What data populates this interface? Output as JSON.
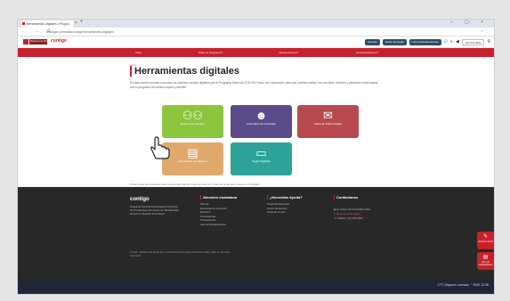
{
  "browser": {
    "tab_title": "Herramientas digitales | Progra...",
    "tab_close": "×",
    "new_tab": "+",
    "window_controls": "–  ▢  ×",
    "nav_icons": "←  →  ⟳",
    "url": "www.gob.pe/midis/contigo/herramientas-digitales",
    "right_icons": "☆  ⋮"
  },
  "gob_header": {
    "ministry_label": "Ministerio de Desarrollo",
    "brand": "contigo",
    "pills": [
      "Atención",
      "Centro de Ayuda",
      "Libro de Reclamaciones"
    ],
    "phone": "(01) 631 8000",
    "icons": [
      "person-icon",
      "settings-icon",
      "speaker-icon",
      "search-icon"
    ]
  },
  "nav": {
    "items": [
      "Inicio",
      "Sobre el programa ▾",
      "Intervenciones ▾",
      "Comunicaciones ▾"
    ]
  },
  "main": {
    "breadcrumb": "Inicio /",
    "title": "Herramientas digitales",
    "intro": "En esta sección podrás encontrar los distintos canales digitales que el Programa Nacional CONTIGO pone a tu disposición para que puedas realizar tus consultas, trámites y gestiones relacionadas con el programa de manera rápida y sencilla.",
    "tiles": [
      {
        "label": "Sistema de Usuarios",
        "icon": "people-icon",
        "color": "#8cc63f"
      },
      {
        "label": "Formulario de Consultas",
        "icon": "group-icon",
        "color": "#5b4b8a"
      },
      {
        "label": "Mesa de Partes Digital",
        "icon": "mail-icon",
        "color": "#b84a4f"
      },
      {
        "label": "Constancias de Afiliación",
        "icon": "document-icon",
        "color": "#e0a96d"
      },
      {
        "label": "Pagos Digitales",
        "icon": "payment-icon",
        "color": "#2fa39a"
      }
    ],
    "footnote": "Todas estas herramientas están disponibles las 24 horas del día, los 7 días de la semana, para tu comodidad."
  },
  "footer": {
    "brand": "contigo",
    "description": "Programa Nacional de Entrega de la Pensión No Contributiva a Personas con Discapacidad Severa en Situación de Pobreza.",
    "columns": [
      {
        "title": "Atención ciudadana",
        "items": [
          "Normas",
          "Denuncias de corrupción",
          "Directorio",
          "Convocatorias",
          "Transparencia",
          "Libro de Reclamaciones"
        ]
      },
      {
        "title": "¿Necesitas Ayuda?",
        "items": [
          "Preguntas frecuentes",
          "Centro de atención",
          "Guías de usuario"
        ]
      }
    ],
    "contact": {
      "title": "Contáctanos",
      "lines": [
        "Av. Paseo de la República 3101",
        "Mesa de partes digital",
        "Teléfono: (01) 631 8000"
      ]
    },
    "legal": "© 2024 – Ministerio de Desarrollo e Inclusión Social. Programa Nacional Contigo. Todos los derechos reservados."
  },
  "widgets": [
    {
      "label": "Atención virtual",
      "icon": "chat-icon"
    },
    {
      "label": "Libro de reclamaciones",
      "icon": "book-icon"
    }
  ],
  "taskbar": {
    "status": "17°C  Mayorm. soleado  ⌃  ENG  12:45"
  }
}
